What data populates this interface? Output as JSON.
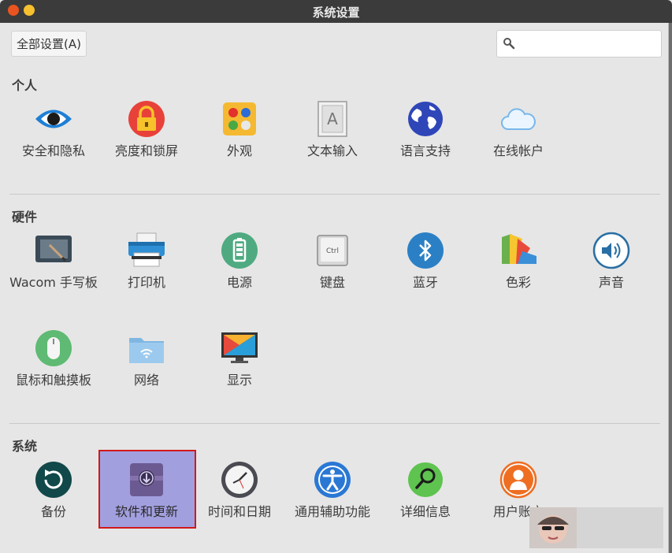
{
  "window": {
    "title": "系统设置"
  },
  "toolbar": {
    "all_settings_label": "全部设置(A)",
    "search_value": ""
  },
  "sections": {
    "personal": {
      "label": "个人",
      "items": [
        {
          "label": "安全和隐私",
          "icon": "eye-icon"
        },
        {
          "label": "亮度和锁屏",
          "icon": "lock-icon"
        },
        {
          "label": "外观",
          "icon": "appearance-palette-icon"
        },
        {
          "label": "文本输入",
          "icon": "text-input-icon"
        },
        {
          "label": "语言支持",
          "icon": "globe-icon"
        },
        {
          "label": "在线帐户",
          "icon": "cloud-icon"
        }
      ]
    },
    "hardware": {
      "label": "硬件",
      "items": [
        {
          "label": "Wacom 手写板",
          "icon": "wacom-tablet-icon"
        },
        {
          "label": "打印机",
          "icon": "printer-icon"
        },
        {
          "label": "电源",
          "icon": "battery-icon"
        },
        {
          "label": "键盘",
          "icon": "keyboard-ctrl-icon"
        },
        {
          "label": "蓝牙",
          "icon": "bluetooth-icon"
        },
        {
          "label": "色彩",
          "icon": "color-icon"
        },
        {
          "label": "声音",
          "icon": "speaker-icon"
        },
        {
          "label": "鼠标和触摸板",
          "icon": "mouse-icon"
        },
        {
          "label": "网络",
          "icon": "network-folder-icon"
        },
        {
          "label": "显示",
          "icon": "display-monitor-icon"
        }
      ]
    },
    "system": {
      "label": "系统",
      "items": [
        {
          "label": "备份",
          "icon": "backup-icon"
        },
        {
          "label": "软件和更新",
          "icon": "software-update-icon",
          "selected": true
        },
        {
          "label": "时间和日期",
          "icon": "clock-icon"
        },
        {
          "label": "通用辅助功能",
          "icon": "accessibility-icon"
        },
        {
          "label": "详细信息",
          "icon": "details-magnifier-icon"
        },
        {
          "label": "用户账户",
          "icon": "user-accounts-icon"
        }
      ]
    }
  },
  "colors": {
    "selection": "#a29fdf",
    "selection_border": "#d11919",
    "titlebar": "#3b3b3b"
  }
}
